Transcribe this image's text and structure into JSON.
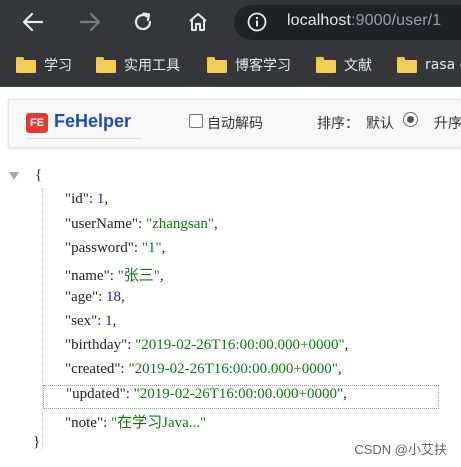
{
  "browser": {
    "url_host": "localhost",
    "url_path": ":9000/user/1"
  },
  "bookmarks": [
    {
      "label": "学习"
    },
    {
      "label": "实用工具"
    },
    {
      "label": "博客学习"
    },
    {
      "label": "文献"
    },
    {
      "label": "rasa d"
    }
  ],
  "fehelper": {
    "logo_text": "FE",
    "name": "FeHelper",
    "auto_decode_label": "自动解码",
    "sort_label": "排序：",
    "sort_default_label": "默认",
    "sort_asc_label": "升序"
  },
  "json_view": {
    "open_brace": "{",
    "close_brace": "}",
    "rows": [
      {
        "key": "\"id\"",
        "sep": ": ",
        "value": "1",
        "type": "num",
        "trail": ","
      },
      {
        "key": "\"userName\"",
        "sep": ": ",
        "value": "\"zhangsan\"",
        "type": "str",
        "trail": ","
      },
      {
        "key": "\"password\"",
        "sep": ": ",
        "value": "\"1\"",
        "type": "str",
        "trail": ","
      },
      {
        "key": "\"name\"",
        "sep": ": ",
        "value": "\"张三\"",
        "type": "str",
        "trail": ","
      },
      {
        "key": "\"age\"",
        "sep": ": ",
        "value": "18",
        "type": "num",
        "trail": ","
      },
      {
        "key": "\"sex\"",
        "sep": ": ",
        "value": "1",
        "type": "num",
        "trail": ","
      },
      {
        "key": "\"birthday\"",
        "sep": ": ",
        "value": "\"2019-02-26T16:00:00.000+0000\"",
        "type": "str",
        "trail": ","
      },
      {
        "key": "\"created\"",
        "sep": ": ",
        "value": "\"2019-02-26T16:00:00.000+0000\"",
        "type": "str",
        "trail": ","
      },
      {
        "key": "\"updated\"",
        "sep": ": ",
        "value": "\"2019-02-26T16:00:00.000+0000\"",
        "type": "str",
        "trail": ","
      },
      {
        "key": "\"note\"",
        "sep": ": ",
        "value": "\"在学习Java...\"",
        "type": "str",
        "trail": ""
      }
    ]
  },
  "watermark": "CSDN @小艾扶",
  "colors": {
    "browser_bar": "#35363a",
    "fehelper_brand": "#1f49b8",
    "json_number": "#1a1aa6",
    "json_string": "#0b7a0b"
  }
}
